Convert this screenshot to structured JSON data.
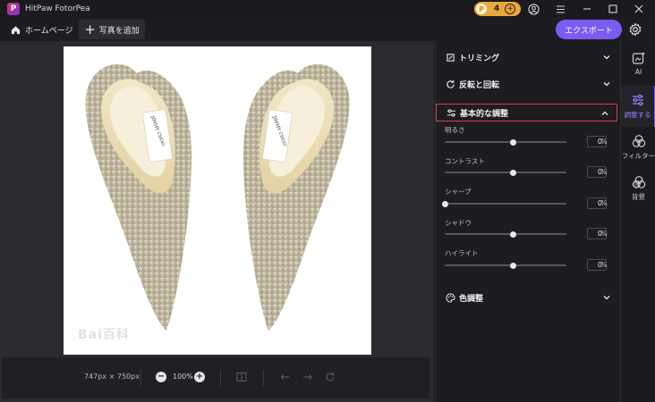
{
  "titlebar": {
    "app_name": "HitPaw FotorPea",
    "credits": "4"
  },
  "toolbar": {
    "home_label": "ホームページ",
    "add_photo_label": "写真を追加",
    "export_label": "エクスポート"
  },
  "canvas": {
    "watermark": "Bai百科"
  },
  "bottombar": {
    "dimensions": "747px × 750px",
    "zoom": "100%"
  },
  "panel": {
    "sections": {
      "trim": "トリミング",
      "flip": "反転と回転",
      "basic": "基本的な調整",
      "color": "色調整"
    },
    "adjustments": [
      {
        "label": "明るさ",
        "value": "0",
        "unit": "%",
        "position": 0.56
      },
      {
        "label": "コントラスト",
        "value": "0",
        "unit": "%",
        "position": 0.56
      },
      {
        "label": "シャープ",
        "value": "0",
        "unit": "%",
        "position": 0.0
      },
      {
        "label": "シャドウ",
        "value": "0",
        "unit": "%",
        "position": 0.56
      },
      {
        "label": "ハイライト",
        "value": "0",
        "unit": "%",
        "position": 0.56
      }
    ]
  },
  "sidetabs": [
    {
      "label": "AI",
      "icon": "ai-sparkle-icon"
    },
    {
      "label": "調整する",
      "icon": "sliders-icon",
      "active": true
    },
    {
      "label": "フィルター",
      "icon": "filter-circles-icon"
    },
    {
      "label": "背景",
      "icon": "background-icon"
    }
  ],
  "colors": {
    "accent": "#7b5bf2",
    "credits_badge": "#e9a83b",
    "highlight_border": "#d6404a"
  }
}
